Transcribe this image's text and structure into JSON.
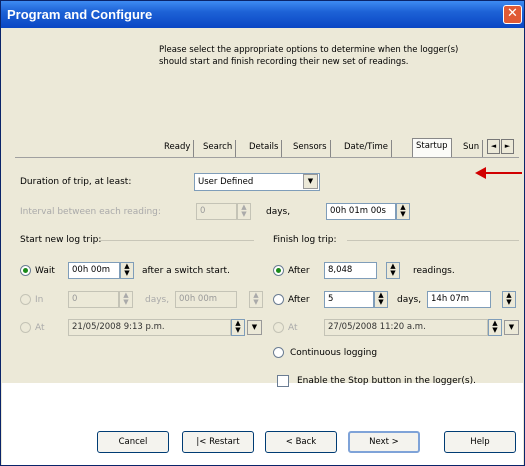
{
  "window": {
    "title": "Program and Configure",
    "close_glyph": "✕",
    "instructions": "Please select the appropriate options to determine when the logger(s) should start and finish recording their new set of readings."
  },
  "tabs": {
    "items": [
      "Ready",
      "Search",
      "Details",
      "Sensors",
      "Date/Time",
      "Startup",
      "Sun"
    ],
    "active": "Startup",
    "scroll_left": "◄",
    "scroll_right": "►"
  },
  "trip": {
    "duration_label": "Duration of trip, at least:",
    "duration_value": "User Defined",
    "interval_label": "Interval between each reading:",
    "interval_days_value": "0",
    "interval_days_unit": "days,",
    "interval_time_value": "00h 01m 00s"
  },
  "start": {
    "heading": "Start new log trip:",
    "wait_label": "Wait",
    "wait_value": "00h 00m",
    "wait_suffix": "after a switch start.",
    "in_label": "In",
    "in_days_value": "0",
    "in_days_unit": "days,",
    "in_time_value": "00h 00m",
    "at_label": "At",
    "at_value": "21/05/2008  9:13 p.m."
  },
  "finish": {
    "heading": "Finish log trip:",
    "after_readings_label": "After",
    "after_readings_value": "8,048",
    "after_readings_unit": "readings.",
    "after_days_label": "After",
    "after_days_value": "5",
    "after_days_unit": "days,",
    "after_time_value": "14h 07m",
    "at_label": "At",
    "at_value": "27/05/2008  11:20 a.m.",
    "continuous_label": "Continuous logging",
    "stop_button_label": "Enable the Stop button in the logger(s)."
  },
  "buttons": {
    "cancel": "Cancel",
    "restart": "|< Restart",
    "back": "< Back",
    "next": "Next >",
    "help": "Help"
  },
  "colors": {
    "annotation_arrow": "#d10000",
    "title_bar": "#0a46c4"
  }
}
